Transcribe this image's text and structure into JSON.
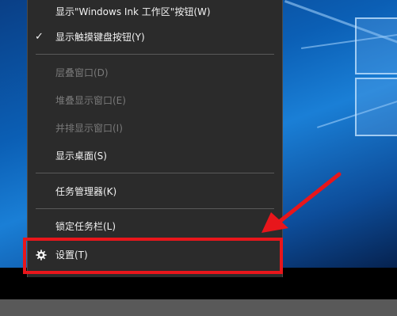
{
  "context_menu": {
    "items": [
      {
        "label": "显示\"Windows Ink 工作区\"按钮(W)",
        "checked": false,
        "disabled": false
      },
      {
        "label": "显示触摸键盘按钮(Y)",
        "checked": true,
        "disabled": false
      },
      {
        "label": "层叠窗口(D)",
        "checked": false,
        "disabled": true
      },
      {
        "label": "堆叠显示窗口(E)",
        "checked": false,
        "disabled": true
      },
      {
        "label": "并排显示窗口(I)",
        "checked": false,
        "disabled": true
      },
      {
        "label": "显示桌面(S)",
        "checked": false,
        "disabled": false
      },
      {
        "label": "任务管理器(K)",
        "checked": false,
        "disabled": false
      },
      {
        "label": "锁定任务栏(L)",
        "checked": false,
        "disabled": false
      },
      {
        "label": "设置(T)",
        "icon": "gear-icon",
        "checked": false,
        "disabled": false
      }
    ],
    "check_mark": "✓"
  },
  "colors": {
    "menu_bg": "#2b2b2b",
    "highlight": "#e8161b",
    "disabled_text": "#7a7a7a"
  }
}
